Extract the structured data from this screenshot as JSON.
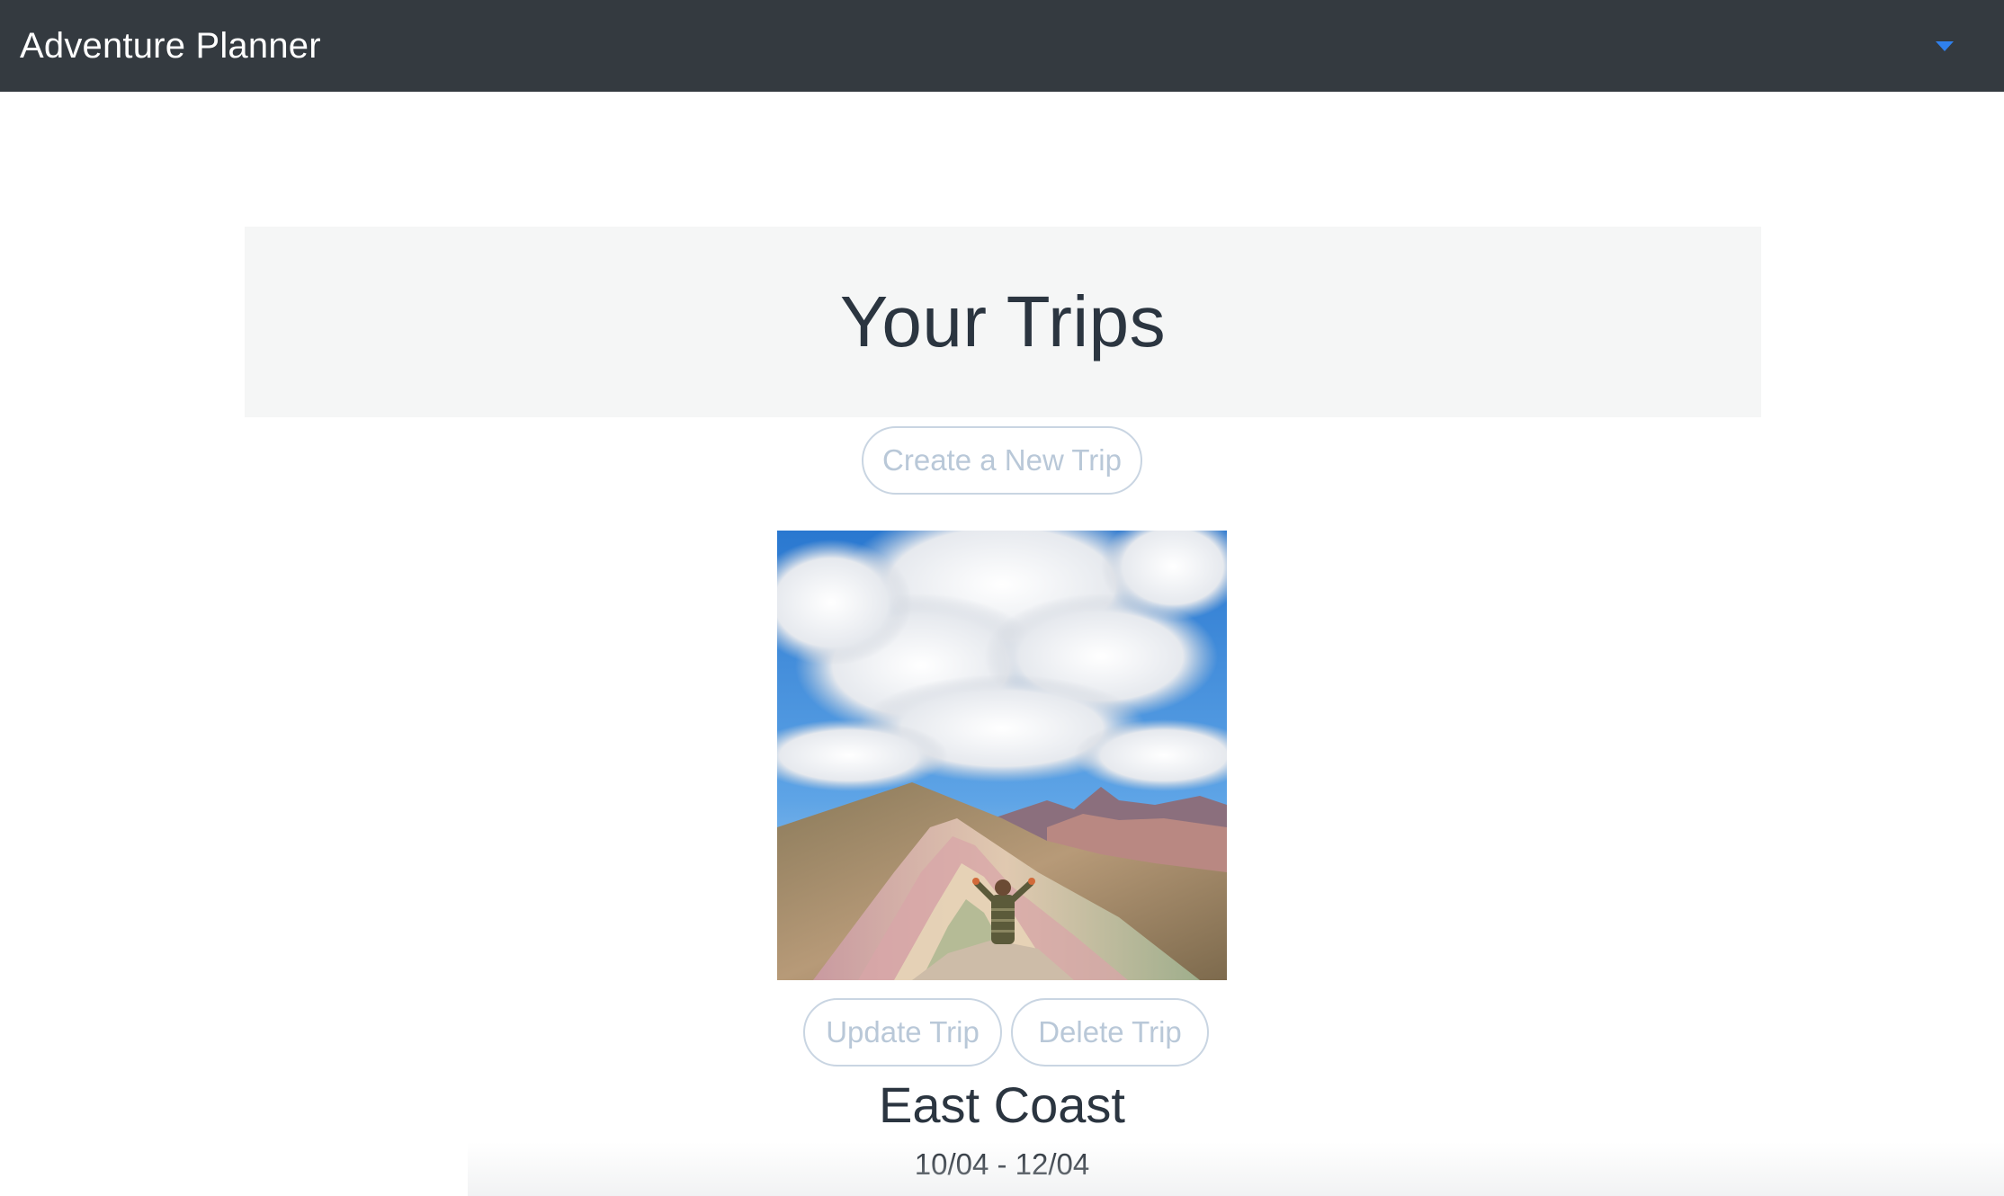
{
  "navbar": {
    "brand": "Adventure Planner",
    "toggle_icon": "caret-down-icon",
    "accent_color": "#2f80ed",
    "background_color": "#343a40"
  },
  "page": {
    "heading": "Your Trips",
    "create_button_label": "Create a New Trip"
  },
  "trips": [
    {
      "image_icon": "mountain-photo",
      "update_label": "Update Trip",
      "delete_label": "Delete Trip",
      "title": "East Coast",
      "dates": "10/04 - 12/04"
    }
  ]
}
